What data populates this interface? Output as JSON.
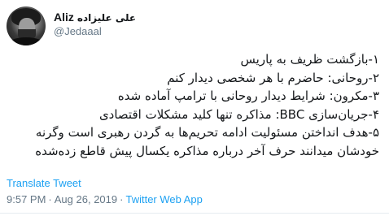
{
  "author": {
    "display_name_latin": "Aliz",
    "display_name_fa": "علی علیزاده",
    "handle": "@Jedaaal"
  },
  "tweet": {
    "lines": [
      "۱-بازگشت ظریف به پاریس",
      "۲-روحانی: حاضرم با هر شخصی دیدار کنم",
      "۳-مکرون: شرایط دیدار روحانی با ترامپ آماده شده",
      "۴-جریان‌سازی BBC: مذاکره تنها کلید مشکلات اقتصادی",
      "۵-هدف انداختن مسئولیت ادامه تحریم‌ها به گردن رهبری است وگرنه",
      "خودشان میدانند حرف آخر درباره مذاکره یکسال پیش قاطع زده‌شده"
    ]
  },
  "translate_label": "Translate Tweet",
  "meta": {
    "time": "9:57 PM",
    "separator": "·",
    "date": "Aug 26, 2019",
    "client": "Twitter Web App"
  },
  "colors": {
    "link": "#1da1f2",
    "secondary_text": "#657786",
    "primary_text": "#14171a"
  }
}
